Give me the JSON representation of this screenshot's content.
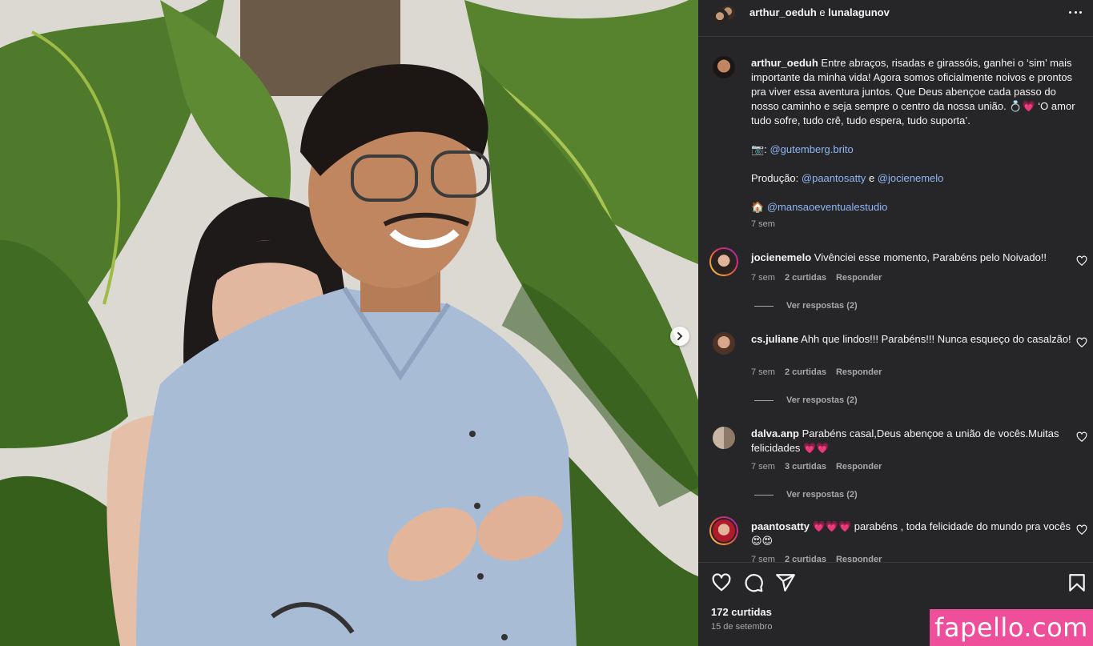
{
  "header": {
    "user1": "arthur_oeduh",
    "conjunction": "e",
    "user2": "lunalagunov"
  },
  "caption": {
    "user": "arthur_oeduh",
    "text": "Entre abraços, risadas e girassóis, ganhei o ‘sim’ mais importante da minha vida! Agora somos oficialmente noivos e prontos pra viver essa aventura juntos. Que Deus abençoe cada passo do nosso caminho e seja sempre o centro da nossa união. 💍💗 ‘O amor tudo sofre, tudo crê, tudo espera, tudo suporta’.",
    "photo_prefix": "📷:",
    "photo_credit": "@gutemberg.brito",
    "production_label": "Produção:",
    "production_1": "@paantosatty",
    "production_and": "e",
    "production_2": "@jocienemelo",
    "venue_prefix": "🏠",
    "venue": "@mansaoeventualestudio",
    "time": "7 sem"
  },
  "comments": [
    {
      "user": "jocienemelo",
      "text": "Vivênciei esse momento, Parabéns pelo Noivado!!",
      "time": "7 sem",
      "likes": "2 curtidas",
      "reply": "Responder",
      "replies": "Ver respostas (2)"
    },
    {
      "user": "cs.juliane",
      "text": "Ahh que lindos!!! Parabéns!!! Nunca esqueço do casalzão!",
      "time": "7 sem",
      "likes": "2 curtidas",
      "reply": "Responder",
      "replies": "Ver respostas (2)"
    },
    {
      "user": "dalva.anp",
      "text": "Parabéns casal,Deus abençoe a união de vocês.Muitas felicidades 💗💗",
      "time": "7 sem",
      "likes": "3 curtidas",
      "reply": "Responder",
      "replies": "Ver respostas (2)"
    },
    {
      "user": "paantosatty",
      "text": "💗💗💗 parabéns , toda felicidade do mundo pra vocês 😍😍",
      "time": "7 sem",
      "likes": "2 curtidas",
      "reply": "Responder"
    }
  ],
  "footer": {
    "likes": "172 curtidas",
    "date": "15 de setembro"
  },
  "watermark": "fapello.com",
  "icons": [
    "heart-icon",
    "comment-icon",
    "share-icon",
    "bookmark-icon",
    "more-icon",
    "chevron-right-icon"
  ],
  "colors": {
    "panel_bg": "#262629",
    "link": "#8fb6f5",
    "watermark_bg": "#ef4f9a"
  }
}
